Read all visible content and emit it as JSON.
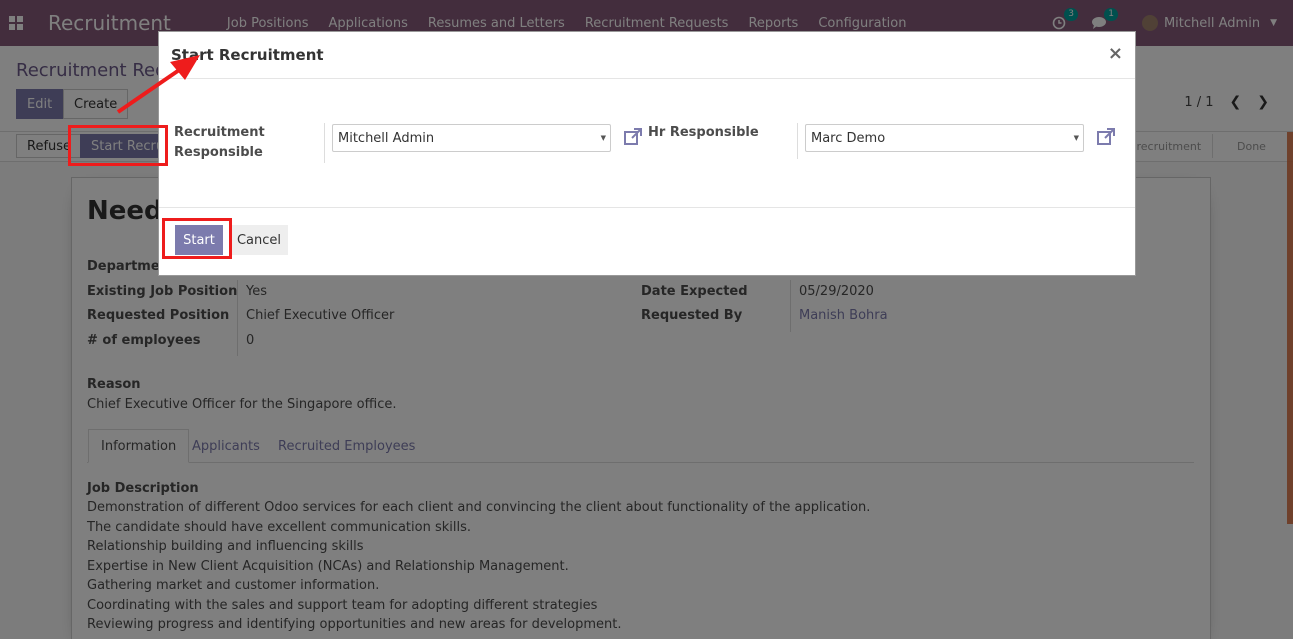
{
  "navbar": {
    "app_name": "Recruitment",
    "menu": [
      "Job Positions",
      "Applications",
      "Resumes and Letters",
      "Recruitment Requests",
      "Reports",
      "Configuration"
    ],
    "activity_badge": "3",
    "messages_badge": "1",
    "user_name": "Mitchell Admin"
  },
  "control_panel": {
    "breadcrumb": "Recruitment Requ",
    "edit_label": "Edit",
    "create_label": "Create",
    "pager_value": "1 / 1"
  },
  "statusbar": {
    "refuse_label": "Refuse",
    "start_label": "Start Recruitment",
    "stage_in_recruitment": "n recruitment",
    "stage_done": "Done"
  },
  "form": {
    "title": "Needs",
    "fields": {
      "department_label": "Department",
      "existing_job_label": "Existing Job Position",
      "existing_job_value": "Yes",
      "requested_position_label": "Requested Position",
      "requested_position_value": "Chief Executive Officer",
      "employees_label": "# of employees",
      "employees_value": "0",
      "date_expected_label": "Date Expected",
      "date_expected_value": "05/29/2020",
      "requested_by_label": "Requested By",
      "requested_by_value": "Manish Bohra"
    },
    "reason_label": "Reason",
    "reason_value": "Chief Executive Officer for the Singapore office.",
    "tabs": [
      "Information",
      "Applicants",
      "Recruited Employees"
    ],
    "job_description_label": "Job Description",
    "job_description_lines": [
      "Demonstration of different Odoo services for each client and convincing the client about functionality of the application.",
      "The candidate should have excellent communication skills.",
      "Relationship building and influencing skills",
      "Expertise in New Client Acquisition (NCAs) and Relationship Management.",
      "Gathering market and customer information.",
      "Coordinating with the sales and support team for adopting different strategies",
      "Reviewing progress and identifying opportunities and new areas for development."
    ]
  },
  "modal": {
    "title": "Start Recruitment",
    "close_symbol": "×",
    "recruitment_responsible_label_1": "Recruitment",
    "recruitment_responsible_label_2": "Responsible",
    "recruitment_responsible_value": "Mitchell Admin",
    "hr_responsible_label": "Hr Responsible",
    "hr_responsible_value": "Marc Demo",
    "start_label": "Start",
    "cancel_label": "Cancel"
  },
  "colors": {
    "brand": "#875a7b",
    "primary_button": "#7c7bad",
    "annotation_red": "#ee1c1c"
  }
}
